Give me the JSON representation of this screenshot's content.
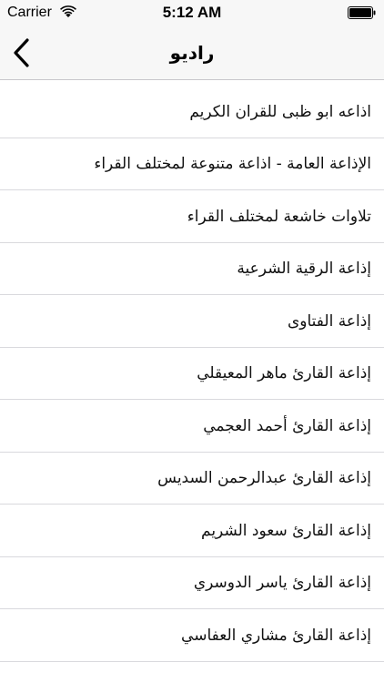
{
  "status_bar": {
    "carrier": "Carrier",
    "time": "5:12 AM",
    "wifi_icon": "wifi-icon",
    "battery_icon": "battery-icon"
  },
  "nav": {
    "back_icon": "chevron-left-icon",
    "title": "راديو"
  },
  "stations": [
    {
      "label": "اذاعه ابو ظبى للقران الكريم"
    },
    {
      "label": "الإذاعة العامة - اذاعة متنوعة لمختلف القراء"
    },
    {
      "label": "تلاوات خاشعة لمختلف القراء"
    },
    {
      "label": "إذاعة الرقية الشرعية"
    },
    {
      "label": "إذاعة الفتاوى"
    },
    {
      "label": "إذاعة القارئ ماهر المعيقلي"
    },
    {
      "label": "إذاعة القارئ أحمد العجمي"
    },
    {
      "label": "إذاعة القارئ عبدالرحمن السديس"
    },
    {
      "label": "إذاعة القارئ سعود الشريم"
    },
    {
      "label": "إذاعة القارئ ياسر الدوسري"
    },
    {
      "label": "إذاعة القارئ مشاري العفاسي"
    }
  ]
}
